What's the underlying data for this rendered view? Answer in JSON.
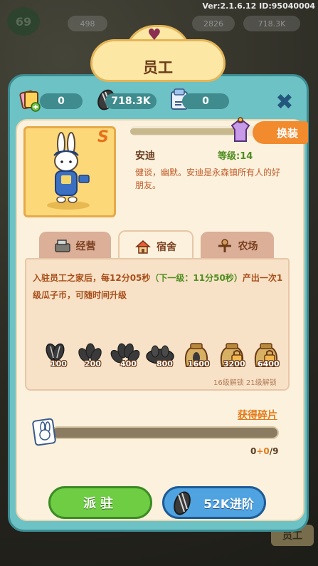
{
  "version": "Ver:2.1.6.12 ID:95040004",
  "background": {
    "player_level": "69",
    "pill_values": [
      "498",
      "2826",
      "718.3K"
    ],
    "corner_button": "员工"
  },
  "title": "员工",
  "currency": {
    "cards": "0",
    "seeds": "718.3K",
    "vouchers": "0"
  },
  "character": {
    "rank": "S",
    "name": "安迪",
    "level": "等级:14",
    "description": "健谈，幽默。安迪是永森镇所有人的好朋友。",
    "swap_label": "换装"
  },
  "tabs": [
    {
      "label": "经营",
      "icon": "cash-register-icon"
    },
    {
      "label": "宿舍",
      "icon": "house-icon"
    },
    {
      "label": "农场",
      "icon": "scarecrow-icon"
    }
  ],
  "dorm": {
    "text_main": "入驻员工之家后，每12分05秒",
    "text_next": "（下一级：11分50秒）",
    "text_tail": "产出一次1级瓜子币，可随时间升级",
    "seed_values": [
      "100",
      "200",
      "400",
      "800",
      "1600",
      "3200",
      "6400"
    ],
    "unlock_note": "16级解锁 21级解锁"
  },
  "fragments": {
    "link": "获得碎片",
    "owned": "0",
    "bonus": "+0",
    "required": "/9",
    "progress": 0
  },
  "buttons": {
    "dispatch": "派驻",
    "advance": "52K进阶"
  },
  "colors": {
    "panel": "#6cc2c4",
    "parchment": "#fbf1dd",
    "dispatch": "#6fcd43",
    "advance": "#4fa3e0",
    "accent": "#f28a2e"
  }
}
